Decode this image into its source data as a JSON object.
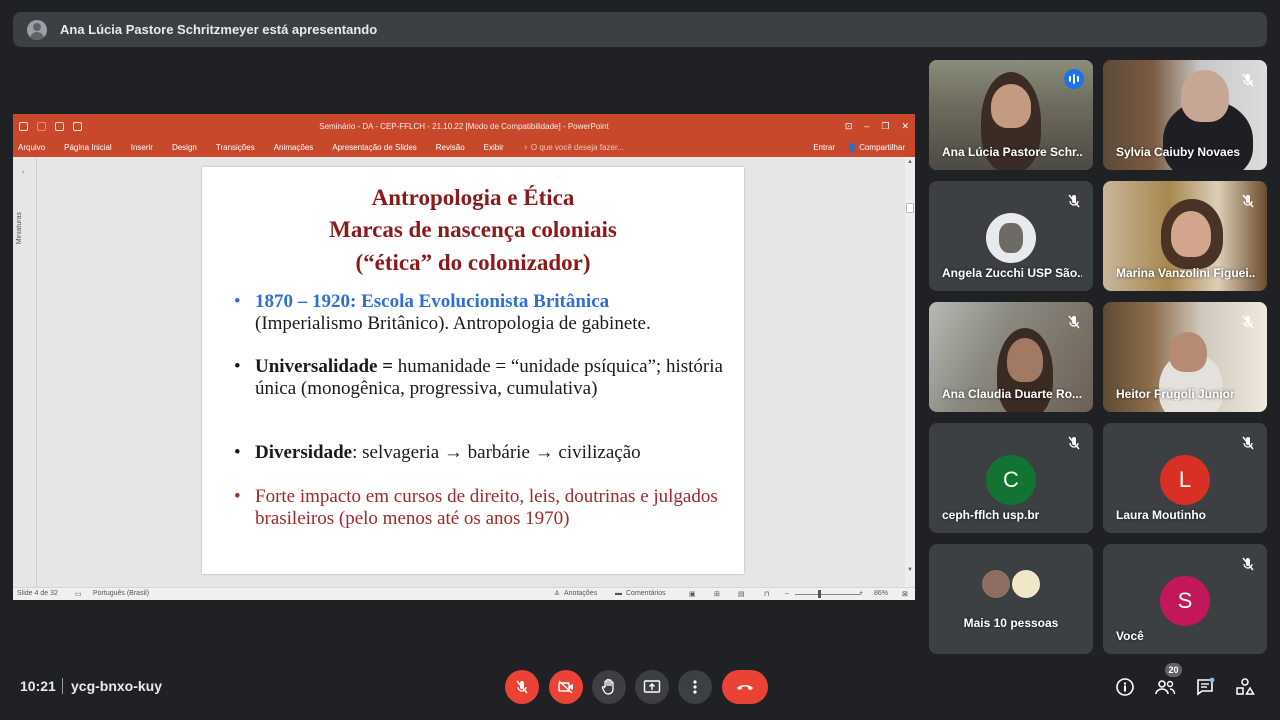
{
  "presenter_banner": "Ana Lúcia Pastore Schritzmeyer está apresentando",
  "ppt": {
    "doc_title": "Seminário - DA - CEP-FFLCH - 21.10.22 [Modo de Compatibilidade] - PowerPoint",
    "window_buttons": [
      "⊡",
      "–",
      "❐",
      "✕"
    ],
    "ribbon_tabs": [
      "Arquivo",
      "Página Inicial",
      "Inserir",
      "Design",
      "Transições",
      "Animações",
      "Apresentação de Slides",
      "Revisão",
      "Exibir"
    ],
    "tell_me": "♀ O que você deseja fazer...",
    "sign_in": "Entrar",
    "share": "Compartilhar",
    "thumbnails_label": "Miniaturas",
    "status": {
      "slide_of": "Slide 4 de 32",
      "language": "Português (Brasil)",
      "notes": "Anotações",
      "comments": "Comentários",
      "zoom": "86%"
    }
  },
  "slide": {
    "title_line1": "Antropologia e Ética",
    "title_line2": "Marcas de nascença coloniais",
    "title_line3": "(“ética” do colonizador)",
    "bullet_char": "•",
    "b1_bold": "1870 – 1920: Escola Evolucionista Britânica",
    "b1_rest": "(Imperialismo Britânico). Antropologia de gabinete.",
    "b2_bold": "Universalidade =",
    "b2_rest": " humanidade = “unidade psíquica”; história única (monogênica, progressiva, cumulativa)",
    "b3_bold": "Diversidade",
    "b3_rest": ": selvageria → barbárie → civilização",
    "b4": "Forte impacto em cursos de direito, leis, doutrinas e julgados brasileiros (pelo menos até os anos 1970)"
  },
  "participants": [
    {
      "name": "Ana Lúcia Pastore Schr..."
    },
    {
      "name": "Sylvia Caiuby Novaes"
    },
    {
      "name": "Angela Zucchi USP São..."
    },
    {
      "name": "Marina Vanzolini Figuei..."
    },
    {
      "name": "Ana Claudia Duarte Ro..."
    },
    {
      "name": "Heitor Frúgoli Junior"
    },
    {
      "name": "ceph-fflch usp.br",
      "initial": "C"
    },
    {
      "name": "Laura Moutinho",
      "initial": "L"
    },
    {
      "name": "Mais 10 pessoas"
    },
    {
      "name": "Você",
      "initial": "S"
    }
  ],
  "colors": {
    "ppt_accent": "#c7482b",
    "title_red": "#8b1a1a",
    "bullet_blue": "#2e6fd6",
    "avatar_c": "#137333",
    "avatar_l": "#d93025",
    "avatar_s": "#c2185b",
    "end_call": "#ea4335"
  },
  "footer": {
    "time": "10:21",
    "meeting_code": "ycg-bnxo-kuy",
    "participant_count": "20"
  }
}
